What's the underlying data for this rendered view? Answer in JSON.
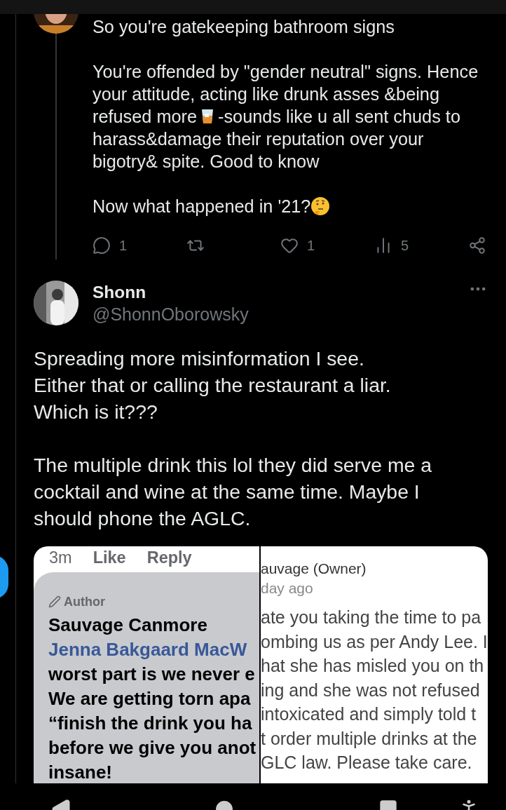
{
  "reply_tweet": {
    "body": [
      [
        [
          "So you're gatekeeping bathroom signs"
        ]
      ],
      [
        [
          "You're offended by \"gender neutral\" signs. Hence"
        ],
        [
          "your attitude, acting like drunk asses &being"
        ],
        [
          "refused more",
          "-sounds like u all sent chuds to"
        ],
        [
          "harass&damage their reputation over your"
        ],
        [
          "bigotry& spite. Good to know"
        ]
      ],
      [
        [
          "Now what happened in '21?"
        ]
      ]
    ],
    "actions": [
      {
        "kind": "reply",
        "count": "1"
      },
      {
        "kind": "repost"
      },
      {
        "kind": "like",
        "count": "1"
      },
      {
        "kind": "views",
        "count": "5"
      },
      {
        "kind": "share"
      }
    ]
  },
  "tweet": {
    "name": "Shonn",
    "handle": "@ShonnOborowsky",
    "body": [
      [
        "Spreading more misinformation I see.",
        "Either that or calling the restaurant a liar.",
        "Which is it???"
      ],
      [
        "The multiple drink this lol they did serve me a",
        "cocktail and wine at the same time. Maybe I",
        "should phone the AGLC."
      ]
    ],
    "image": {
      "left": {
        "meta": [
          "3m",
          "Like",
          "Reply"
        ],
        "badge": "Author",
        "author": "Sauvage Canmore",
        "mention": "Jenna Bakgaard MacW",
        "lines": [
          "worst part is we never e",
          "We are getting torn apa",
          "“finish the drink you ha",
          "before we give you anot",
          "insane!"
        ]
      },
      "right": {
        "title": "auvage (Owner)",
        "time": "day ago",
        "lines": [
          "ate you taking the time to pa",
          "ombing us as per Andy Lee. I",
          "hat she has misled you on th",
          "ing and she was not refused",
          "intoxicated and simply told t",
          "t order multiple drinks at the",
          "GLC law. Please take care."
        ]
      }
    }
  }
}
